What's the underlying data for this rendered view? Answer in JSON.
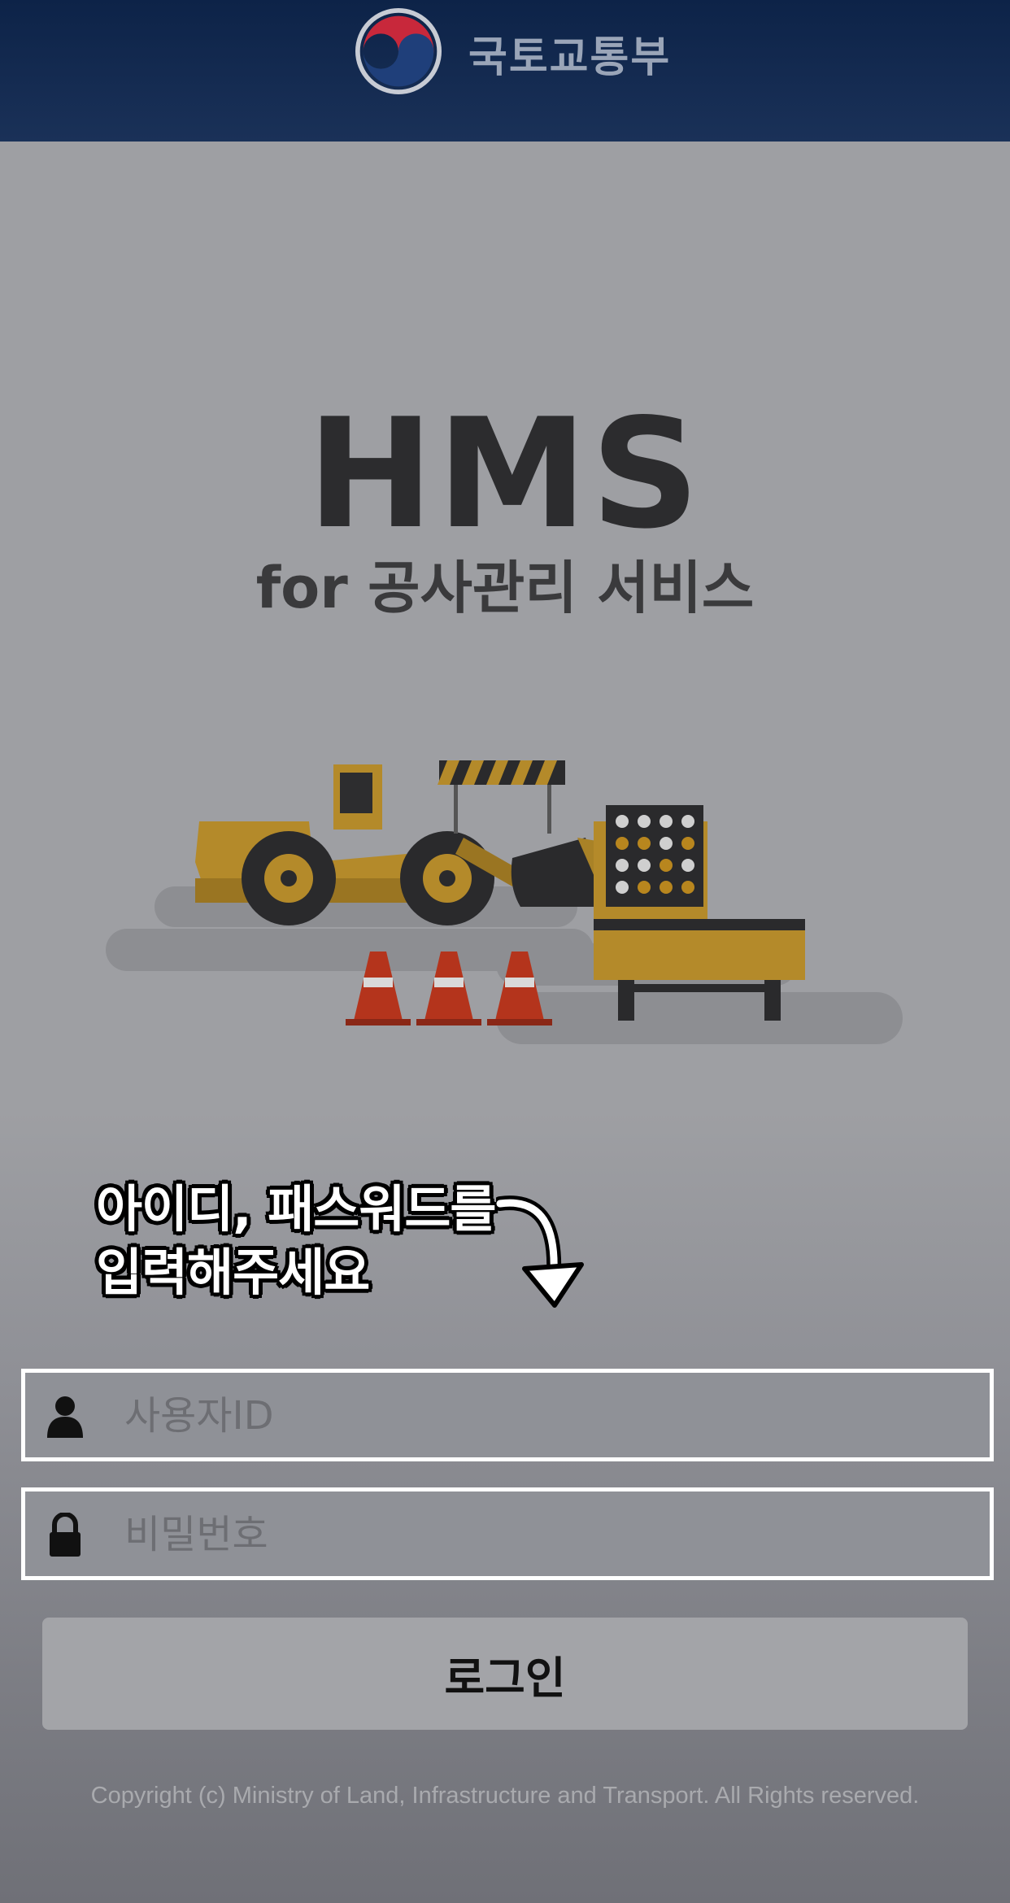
{
  "header": {
    "ministry_name": "국토교통부",
    "logo_icon": "taegeuk-emblem-icon",
    "background": "#0d2348"
  },
  "app": {
    "title": "HMS",
    "subtitle": "for 공사관리 서비스"
  },
  "hint": {
    "line1": "아이디, 패스워드를",
    "line2": "입력해주세요",
    "arrow_icon": "curved-arrow-down-icon"
  },
  "login_form": {
    "user_id": {
      "placeholder": "사용자ID",
      "value": "",
      "icon": "user-icon"
    },
    "password": {
      "placeholder": "비밀번호",
      "value": "",
      "icon": "lock-icon"
    },
    "submit_label": "로그인"
  },
  "footer": {
    "copyright": "Copyright (c) Ministry of Land, Infrastructure and Transport. All Rights reserved."
  }
}
